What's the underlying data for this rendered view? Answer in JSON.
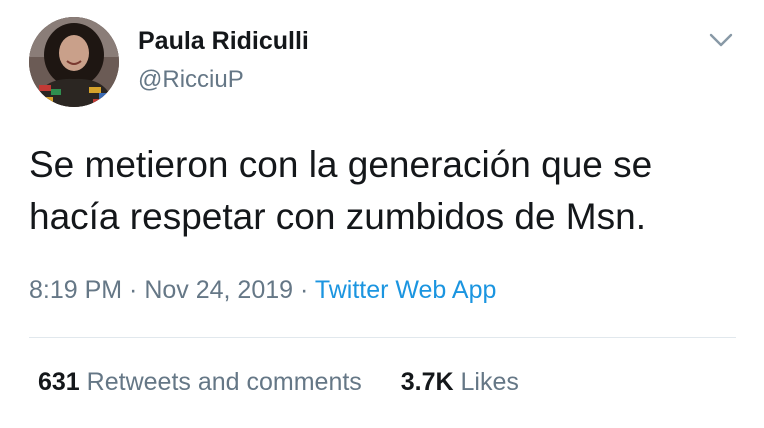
{
  "tweet": {
    "author": {
      "display_name": "Paula Ridiculli",
      "handle": "@RicciuP",
      "avatar_icon": "profile-photo"
    },
    "menu_icon": "chevron-down-icon",
    "text_lines": [
      "Se metieron con la generación que se",
      "hacía respetar con zumbidos de Msn."
    ],
    "time": "8:19 PM",
    "separator": " · ",
    "date": "Nov 24, 2019",
    "source": "Twitter Web App",
    "stats": {
      "retweets_count": "631",
      "retweets_label": "Retweets and comments",
      "likes_count": "3.7K",
      "likes_label": "Likes"
    }
  },
  "colors": {
    "text_primary": "#14171a",
    "text_secondary": "#657786",
    "link": "#1b95e0",
    "divider": "#e1e8ed"
  }
}
